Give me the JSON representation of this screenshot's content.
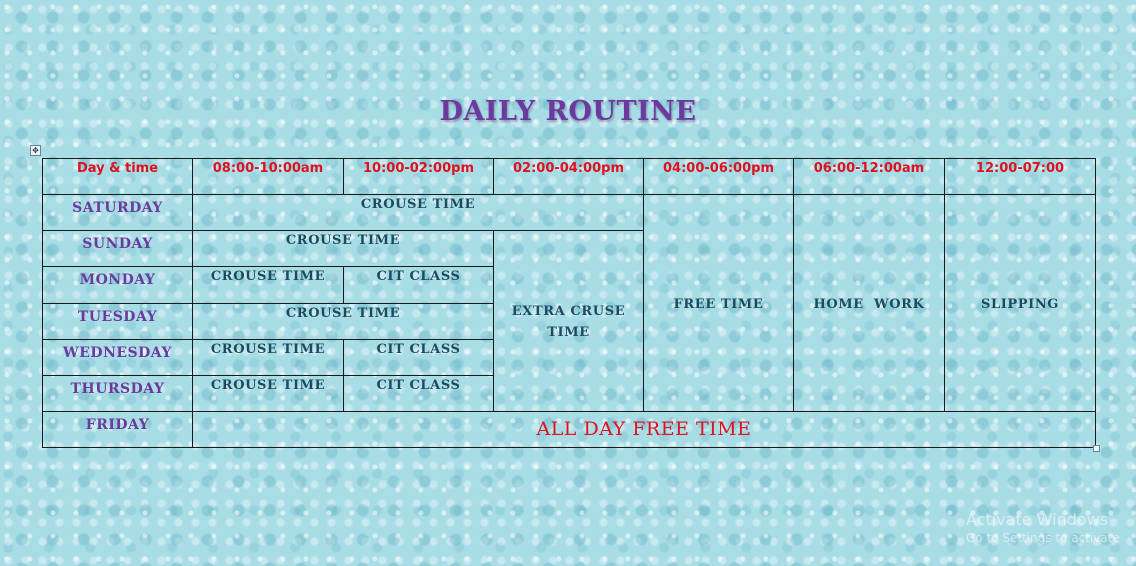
{
  "title": "DAILY ROUTINE",
  "header": [
    "Day & time",
    "08:00-10:00am",
    "10:00-02:00pm",
    "02:00-04:00pm",
    "04:00-06:00pm",
    "06:00-12:00am",
    "12:00-07:00"
  ],
  "days": {
    "saturday": "SATURDAY",
    "sunday": "SUNDAY",
    "monday": "MONDAY",
    "tuesday": "TUESDAY",
    "wednesday": "WEDNESDAY",
    "thursday": "THURSDAY",
    "friday": "FRIDAY"
  },
  "cells": {
    "saturday_morning": "CROUSE TIME",
    "sunday_morning": "CROUSE TIME",
    "monday_slot1": "CROUSE TIME",
    "monday_slot2": "CIT CLASS",
    "tuesday_morning": "CROUSE TIME",
    "wednesday_slot1": "CROUSE TIME",
    "wednesday_slot2": "CIT CLASS",
    "thursday_slot1": "CROUSE TIME",
    "thursday_slot2": "CIT CLASS",
    "extra": "EXTRA CRUSE TIME",
    "free_time": "FREE TIME",
    "home_work": "HOME  WORK",
    "slipping": "SLIPPING",
    "friday_all": "ALL DAY FREE TIME"
  },
  "table_handle_icon": "move-icon",
  "watermark": {
    "line1": "Activate Windows",
    "line2": "Go to Settings to activate"
  },
  "colors": {
    "header_text": "#e0101e",
    "day_text": "#6b3a9c",
    "activity_text": "#1e4a5e",
    "background": "#a9dde6"
  }
}
